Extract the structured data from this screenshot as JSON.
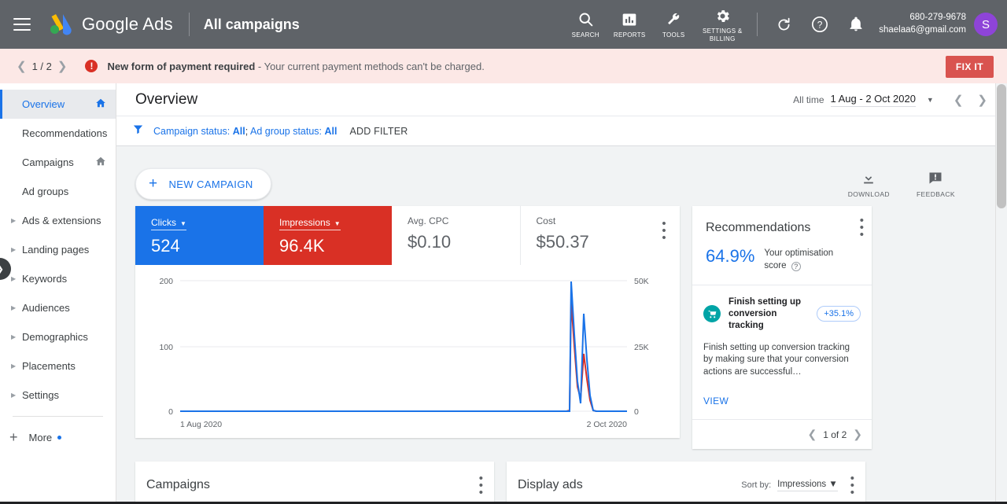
{
  "topbar": {
    "menu_icon": "hamburger-icon",
    "brand": "Google Ads",
    "brand_google": "Google",
    "brand_ads": "Ads",
    "scope": "All campaigns",
    "tools": [
      {
        "icon": "search-icon",
        "label": "SEARCH"
      },
      {
        "icon": "reports-icon",
        "label": "REPORTS"
      },
      {
        "icon": "wrench-icon",
        "label": "TOOLS"
      },
      {
        "icon": "gear-icon",
        "label": "SETTINGS &\nBILLING",
        "label_line1": "SETTINGS &",
        "label_line2": "BILLING"
      }
    ],
    "refresh_icon": "refresh-icon",
    "help_icon": "help-icon",
    "bell_icon": "notification-bell-icon",
    "account_id": "680-279-9678",
    "account_email": "shaelaa6@gmail.com",
    "avatar_letter": "S"
  },
  "alert": {
    "prev_icon": "chevron-left-icon",
    "pager": "1 / 2",
    "next_icon": "chevron-right-icon",
    "error_icon": "error-exclamation-icon",
    "title": "New form of payment required",
    "separator": " - ",
    "message": "Your current payment methods can't be charged.",
    "fix_button": "FIX IT"
  },
  "sidebar": {
    "items": [
      {
        "label": "Overview",
        "active": true,
        "home": true,
        "expandable": false
      },
      {
        "label": "Recommendations",
        "active": false,
        "home": false,
        "expandable": false
      },
      {
        "label": "Campaigns",
        "active": false,
        "home": true,
        "expandable": false
      },
      {
        "label": "Ad groups",
        "active": false,
        "home": false,
        "expandable": false
      },
      {
        "label": "Ads & extensions",
        "active": false,
        "home": false,
        "expandable": true
      },
      {
        "label": "Landing pages",
        "active": false,
        "home": false,
        "expandable": true
      },
      {
        "label": "Keywords",
        "active": false,
        "home": false,
        "expandable": true
      },
      {
        "label": "Audiences",
        "active": false,
        "home": false,
        "expandable": true
      },
      {
        "label": "Demographics",
        "active": false,
        "home": false,
        "expandable": true
      },
      {
        "label": "Placements",
        "active": false,
        "home": false,
        "expandable": true
      },
      {
        "label": "Settings",
        "active": false,
        "home": false,
        "expandable": true
      }
    ],
    "more_label": "More",
    "collapse_icon": "expand-sidebar-icon"
  },
  "header": {
    "title": "Overview",
    "date_label": "All time",
    "date_value": "1 Aug - 2 Oct 2020",
    "date_caret": "chevron-down-icon",
    "prev_icon": "chevron-left-icon",
    "next_icon": "chevron-right-icon"
  },
  "filters": {
    "funnel_icon": "filter-funnel-icon",
    "campaign_status_label": "Campaign status: ",
    "campaign_status_value": "All",
    "semicolon": "; ",
    "adgroup_status_label": "Ad group status: ",
    "adgroup_status_value": "All",
    "add_filter": "ADD FILTER"
  },
  "actions": {
    "new_campaign": "NEW CAMPAIGN",
    "plus_icon": "plus-icon",
    "download": {
      "icon": "download-icon",
      "label": "DOWNLOAD"
    },
    "feedback": {
      "icon": "feedback-icon",
      "label": "FEEDBACK"
    }
  },
  "metrics": [
    {
      "label": "Clicks",
      "value": "524",
      "selected": "blue",
      "color": "#1a73e8"
    },
    {
      "label": "Impressions",
      "value": "96.4K",
      "selected": "red",
      "color": "#d93025"
    },
    {
      "label": "Avg. CPC",
      "value": "$0.10",
      "selected": "none",
      "color": "#5f6368"
    },
    {
      "label": "Cost",
      "value": "$50.37",
      "selected": "none",
      "color": "#5f6368"
    }
  ],
  "chart_data": {
    "type": "line",
    "title": "",
    "xlabel": "",
    "ylabel": "Clicks",
    "y2label": "Impressions",
    "x_tick_labels": [
      "1 Aug 2020",
      "2 Oct 2020"
    ],
    "left_axis": {
      "ticks": [
        0,
        100,
        200
      ],
      "tick_labels": [
        "0",
        "100",
        "200"
      ],
      "ylim": [
        0,
        200
      ]
    },
    "right_axis": {
      "ticks": [
        0,
        25000,
        50000
      ],
      "tick_labels": [
        "0",
        "25K",
        "50K"
      ],
      "ylim": [
        0,
        50000
      ]
    },
    "grid": true,
    "legend": "none",
    "series": [
      {
        "name": "Clicks",
        "color": "#1a73e8",
        "axis": "left",
        "x": [
          0,
          10,
          20,
          30,
          40,
          50,
          60,
          70,
          80,
          85,
          87,
          88,
          89,
          90,
          91,
          92,
          93,
          94,
          95,
          96,
          97,
          100
        ],
        "values": [
          0,
          0,
          0,
          0,
          0,
          0,
          0,
          0,
          0,
          0,
          0,
          0,
          196,
          120,
          40,
          12,
          148,
          90,
          30,
          2,
          0,
          0
        ]
      },
      {
        "name": "Impressions",
        "color": "#d93025",
        "axis": "right",
        "x": [
          0,
          10,
          20,
          30,
          40,
          50,
          60,
          70,
          80,
          85,
          87,
          88,
          89,
          90,
          91,
          92,
          93,
          94,
          95,
          96,
          97,
          100
        ],
        "values": [
          0,
          0,
          0,
          0,
          0,
          0,
          0,
          0,
          0,
          0,
          0,
          0,
          43500,
          23000,
          8500,
          4000,
          24000,
          14000,
          5000,
          500,
          0,
          0
        ]
      }
    ]
  },
  "recommendations": {
    "title": "Recommendations",
    "kebab_icon": "more-options-icon",
    "score_value": "64.9%",
    "score_text_line1": "Your optimisation",
    "score_text_line2": "score",
    "help_icon": "help-circle-icon",
    "item": {
      "icon": "conversion-cart-icon",
      "title_line1": "Finish setting up",
      "title_line2": "conversion tracking",
      "badge": "+35.1%",
      "description": "Finish setting up conversion tracking by making sure that your conversion actions are successful…",
      "view_label": "VIEW"
    },
    "footer": {
      "prev_icon": "chevron-left-icon",
      "pager": "1 of 2",
      "next_icon": "chevron-right-icon"
    }
  },
  "bottom_cards": [
    {
      "title": "Campaigns",
      "kebab_icon": "more-options-icon",
      "has_sort": false
    },
    {
      "title": "Display ads",
      "kebab_icon": "more-options-icon",
      "has_sort": true,
      "sort_label": "Sort by:",
      "sort_value": "Impressions"
    }
  ]
}
